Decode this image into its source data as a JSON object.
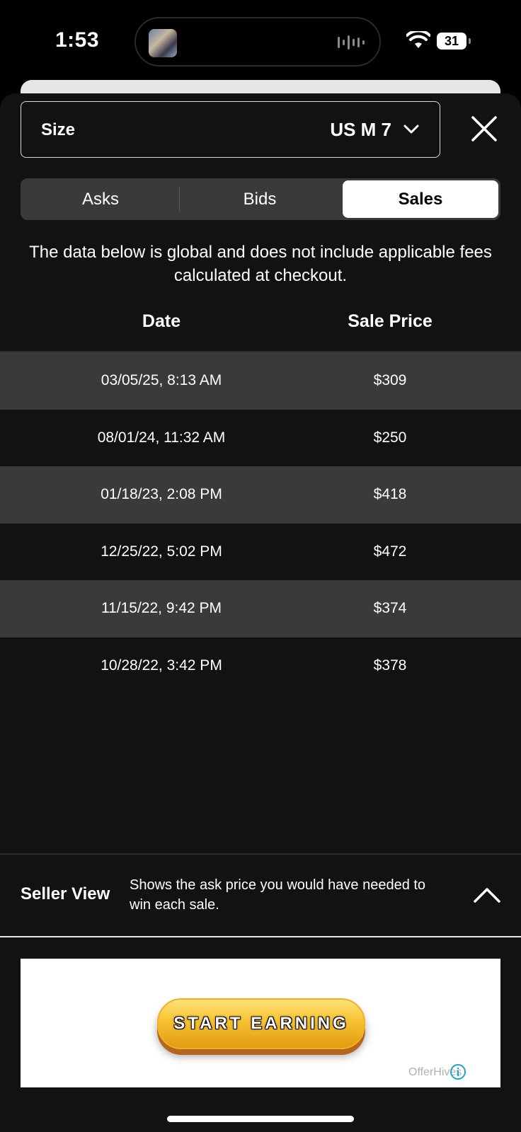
{
  "status_bar": {
    "time": "1:53",
    "battery": "31"
  },
  "size_selector": {
    "label": "Size",
    "value": "US M 7"
  },
  "tabs": [
    {
      "label": "Asks",
      "selected": false
    },
    {
      "label": "Bids",
      "selected": false
    },
    {
      "label": "Sales",
      "selected": true
    }
  ],
  "disclaimer": "The data below is global and does not include applicable fees calculated at checkout.",
  "table": {
    "headers": {
      "date": "Date",
      "price": "Sale Price"
    },
    "rows": [
      {
        "date": "03/05/25, 8:13 AM",
        "price": "$309"
      },
      {
        "date": "08/01/24, 11:32 AM",
        "price": "$250"
      },
      {
        "date": "01/18/23, 2:08 PM",
        "price": "$418"
      },
      {
        "date": "12/25/22, 5:02 PM",
        "price": "$472"
      },
      {
        "date": "11/15/22, 9:42 PM",
        "price": "$374"
      },
      {
        "date": "10/28/22, 3:42 PM",
        "price": "$378"
      }
    ]
  },
  "seller_view": {
    "title": "Seller View",
    "description": "Shows the ask price you would have needed to win each sale."
  },
  "ad": {
    "button_label": "START EARNING",
    "brand": "OfferHives"
  },
  "colors": {
    "sheet_bg": "#121212",
    "row_alt_bg": "#3a3a3a",
    "segment_bg": "#3a3a3c",
    "segment_selected_bg": "#ffffff",
    "ad_button": "#f7c230"
  }
}
